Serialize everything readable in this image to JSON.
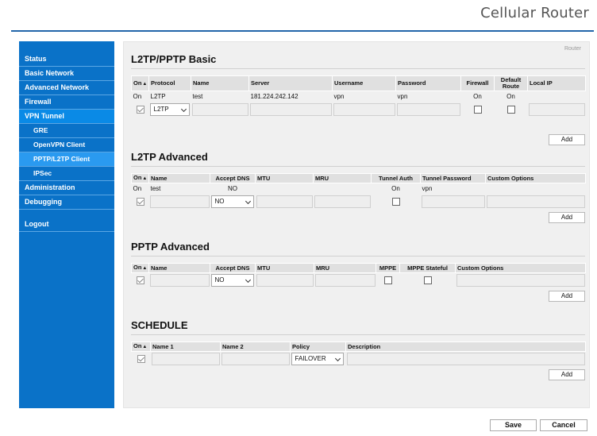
{
  "brand": "Cellular Router",
  "router_tag": "Router",
  "sidebar": {
    "items": [
      {
        "label": "Status"
      },
      {
        "label": "Basic Network"
      },
      {
        "label": "Advanced Network"
      },
      {
        "label": "Firewall"
      },
      {
        "label": "VPN Tunnel"
      },
      {
        "label": "GRE"
      },
      {
        "label": "OpenVPN Client"
      },
      {
        "label": "PPTP/L2TP Client"
      },
      {
        "label": "IPSec"
      },
      {
        "label": "Administration"
      },
      {
        "label": "Debugging"
      },
      {
        "label": "Logout"
      }
    ]
  },
  "basic": {
    "title": "L2TP/PPTP Basic",
    "headers": [
      "On",
      "Protocol",
      "Name",
      "Server",
      "Username",
      "Password",
      "Firewall",
      "Default Route",
      "Local IP"
    ],
    "row": {
      "on": "On",
      "protocol": "L2TP",
      "name": "test",
      "server": "181.224.242.142",
      "username": "vpn",
      "password": "vpn",
      "firewall": "On",
      "default_route": "On",
      "local_ip": ""
    },
    "edit_protocol": "L2TP",
    "add_label": "Add"
  },
  "l2tp": {
    "title": "L2TP Advanced",
    "headers": [
      "On",
      "Name",
      "Accept DNS",
      "MTU",
      "MRU",
      "Tunnel Auth",
      "Tunnel Password",
      "Custom Options"
    ],
    "row": {
      "on": "On",
      "name": "test",
      "accept_dns": "NO",
      "mtu": "",
      "mru": "",
      "tunnel_auth": "On",
      "tunnel_password": "vpn",
      "custom": ""
    },
    "edit_dns": "NO",
    "add_label": "Add"
  },
  "pptp": {
    "title": "PPTP Advanced",
    "headers": [
      "On",
      "Name",
      "Accept DNS",
      "MTU",
      "MRU",
      "MPPE",
      "MPPE Stateful",
      "Custom Options"
    ],
    "edit_dns": "NO",
    "add_label": "Add"
  },
  "schedule": {
    "title": "SCHEDULE",
    "headers": [
      "On",
      "Name 1",
      "Name 2",
      "Policy",
      "Description"
    ],
    "edit_policy": "FAILOVER",
    "add_label": "Add"
  },
  "footer": {
    "save": "Save",
    "cancel": "Cancel"
  }
}
